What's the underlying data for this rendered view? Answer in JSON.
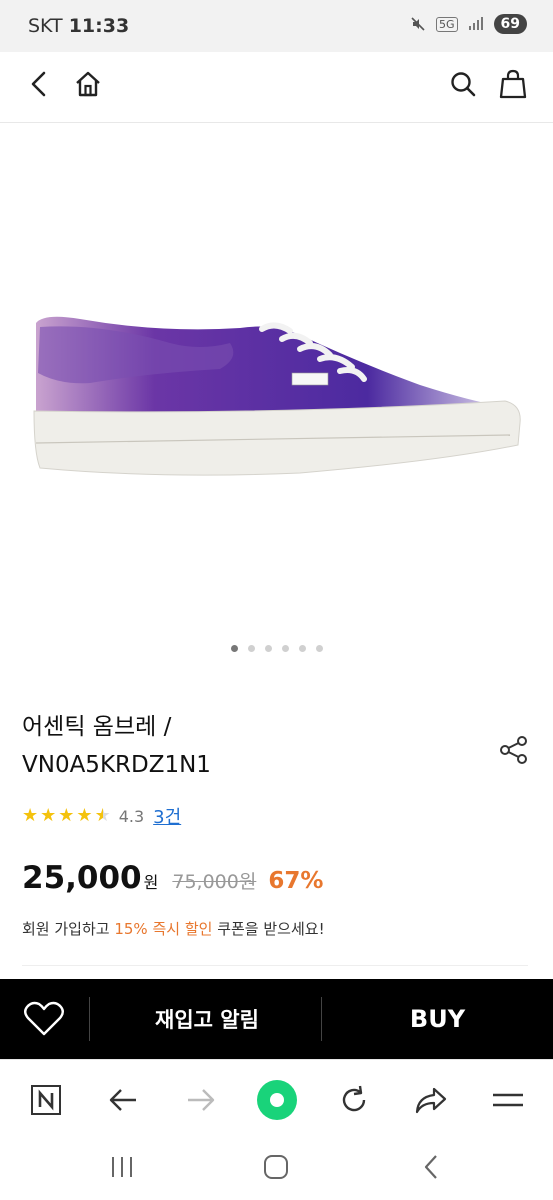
{
  "status": {
    "carrier": "SKT",
    "time": "11:33",
    "battery": "69",
    "network": "5G"
  },
  "header": {
    "back_icon": "back-arrow-icon",
    "home_icon": "home-icon",
    "search_icon": "search-icon",
    "cart_icon": "shopping-bag-icon"
  },
  "gallery": {
    "dot_count": 6,
    "active_index": 0,
    "image": "purple-ombre-sneaker"
  },
  "product": {
    "title_line1": "어센틱 옴브레 /",
    "title_line2": "VN0A5KRDZ1N1",
    "rating": 4.3,
    "rating_label": "4.3",
    "review_count": "3건",
    "price": "25,000",
    "price_unit": "원",
    "original_price": "75,000원",
    "discount": "67%"
  },
  "coupon": {
    "prefix": "회원 가입하고 ",
    "highlight_1": "15%",
    "highlight_2": "즉시 할인",
    "suffix": " 쿠폰을 받으세요!"
  },
  "actions": {
    "restock_label": "재입고 알림",
    "buy_label": "BUY"
  },
  "browser": {
    "icons": [
      "naver-icon",
      "back-icon",
      "forward-icon",
      "green-circle-icon",
      "refresh-icon",
      "share-icon",
      "menu-icon"
    ]
  },
  "colors": {
    "accent": "#e8772e",
    "link": "#1f6fd1",
    "star": "#f4c20d",
    "shoe": "#5a2ea6"
  }
}
